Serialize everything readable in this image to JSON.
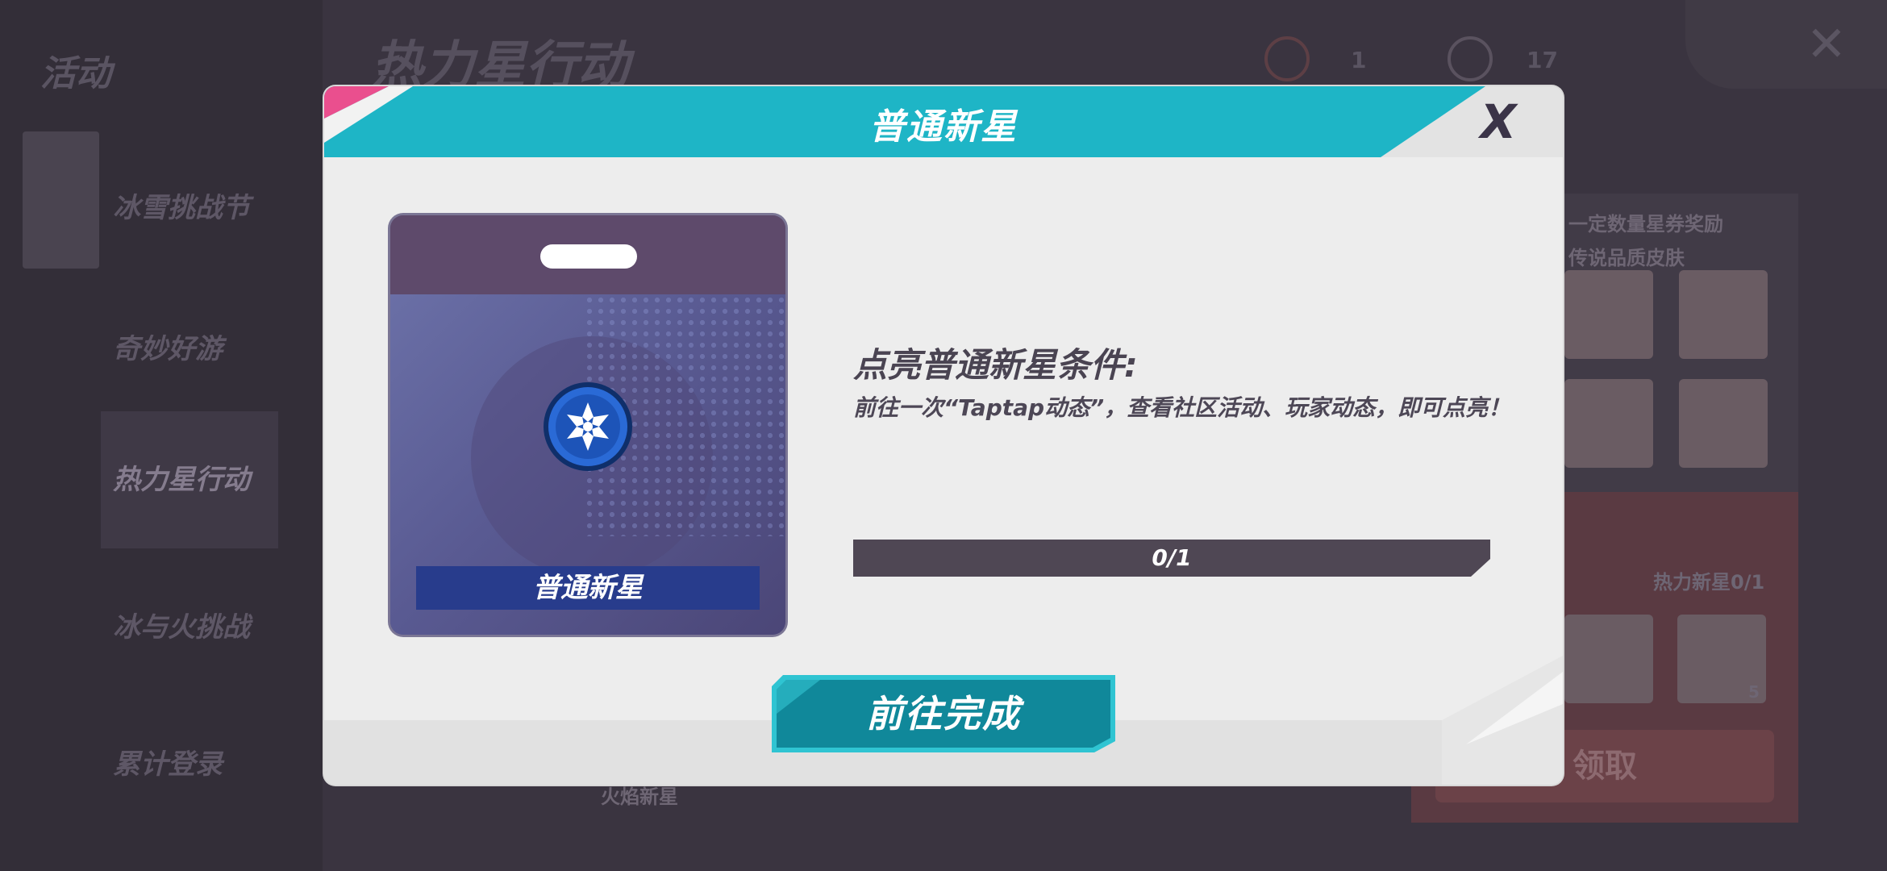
{
  "background": {
    "sidebar_title": "活动",
    "nav_items": [
      {
        "label": "冰雪挑战节"
      },
      {
        "label": "奇妙好游"
      },
      {
        "label": "热力星行动"
      },
      {
        "label": "冰与火挑战"
      },
      {
        "label": "累计登录"
      }
    ],
    "page_heading": "热力星行动",
    "stats": [
      {
        "icon": "medal-icon",
        "value": "1"
      },
      {
        "icon": "star-gauge-icon",
        "value": "17"
      }
    ],
    "panel_text_1": "一定数量星券奖励",
    "panel_text_2": "传说品质皮肤",
    "panel_progress": "热力新星0/1",
    "card_count": "5",
    "claim_label": "领取",
    "bottom_text": "火焰新星"
  },
  "dialog": {
    "title": "普通新星",
    "close_label": "X",
    "badge": {
      "icon": "snowflake-icon",
      "name": "普通新星"
    },
    "condition_title": "点亮普通新星条件:",
    "condition_desc": "前往一次“Taptap动态”，查看社区活动、玩家动态，即可点亮！",
    "progress": {
      "current": 0,
      "total": 1,
      "fraction": 0,
      "text": "0/1"
    },
    "go_button": "前往完成"
  },
  "colors": {
    "header_teal": "#1eb5c6",
    "accent_pink": "#ea4f8e",
    "button_teal": "#10889a",
    "progress_track": "#4f4754"
  }
}
